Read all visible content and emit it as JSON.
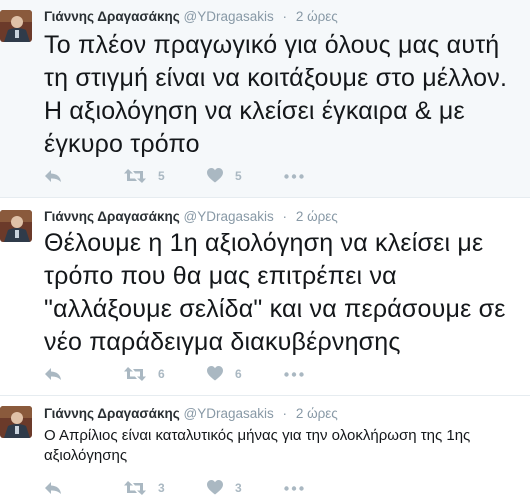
{
  "colors": {
    "icon": "#aab8c2",
    "shaded_background": "#f5f8fa",
    "muted_text": "#8899a6"
  },
  "tweets": [
    {
      "name": "Γιάννης Δραγασάκης",
      "handle": "@YDragasakis",
      "separator": "·",
      "time": "2 ώρες",
      "text": "Το πλέον πραγωγικό για όλους μας αυτή τη στιγμή είναι να κοιτάξουμε στο μέλλον. Η αξιολόγηση να κλείσει έγκαιρα & με έγκυρο τρόπο",
      "retweets": "5",
      "likes": "5",
      "icons": [
        "reply-icon",
        "retweet-icon",
        "heart-icon",
        "more-icon"
      ]
    },
    {
      "name": "Γιάννης Δραγασάκης",
      "handle": "@YDragasakis",
      "separator": "·",
      "time": "2 ώρες",
      "text": "Θέλουμε η 1η αξιολόγηση να κλείσει με τρόπο που θα μας επιτρέπει να \"αλλάξουμε σελίδα\" και να περάσουμε σε νέο παράδειγμα διακυβέρνησης",
      "retweets": "6",
      "likes": "6",
      "icons": [
        "reply-icon",
        "retweet-icon",
        "heart-icon",
        "more-icon"
      ]
    },
    {
      "name": "Γιάννης Δραγασάκης",
      "handle": "@YDragasakis",
      "separator": "·",
      "time": "2 ώρες",
      "text": "Ο Απρίλιος είναι καταλυτικός μήνας για την ολοκλήρωση της 1ης αξιολόγησης",
      "retweets": "3",
      "likes": "3",
      "icons": [
        "reply-icon",
        "retweet-icon",
        "heart-icon",
        "more-icon"
      ]
    }
  ]
}
